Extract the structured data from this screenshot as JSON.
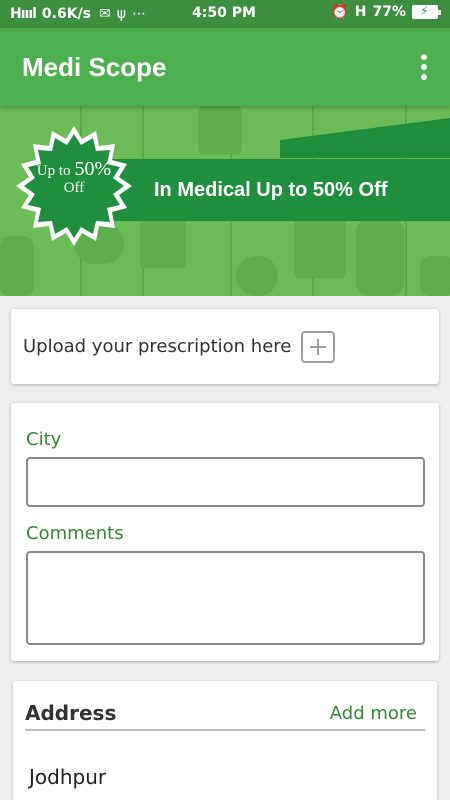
{
  "status_bar": {
    "signal": "H││││",
    "net_speed": "0.6K/s",
    "icons": [
      "mail-icon",
      "usb-icon",
      "more-icon",
      "alarm-icon",
      "h-network-icon"
    ],
    "time": "4:50 PM",
    "battery": "77%"
  },
  "app_bar": {
    "title": "Medi Scope",
    "menu_icon": "overflow-menu-icon"
  },
  "banner": {
    "seal_prefix": "Up to",
    "seal_percent": "50%",
    "seal_suffix": "Off",
    "headline": "In Medical Up to 50% Off"
  },
  "upload": {
    "label": "Upload your prescription here",
    "icon": "plus-icon"
  },
  "form": {
    "city_label": "City",
    "city_value": "",
    "comments_label": "Comments",
    "comments_value": ""
  },
  "address": {
    "title": "Address",
    "add_more": "Add more",
    "city": "Jodhpur"
  },
  "colors": {
    "status_bar": "#3d8f3f",
    "app_bar": "#4caf50",
    "accent_green": "#2e8b32",
    "ribbon": "#1f8f3e"
  }
}
